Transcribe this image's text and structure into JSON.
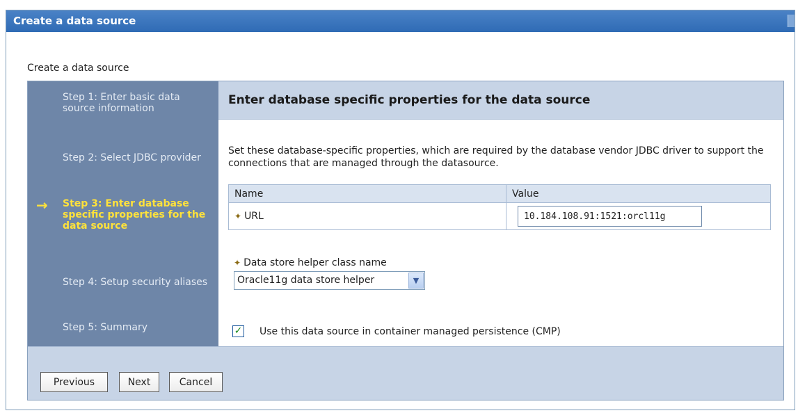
{
  "window": {
    "title": "Create a data source"
  },
  "page": {
    "heading": "Create a data source"
  },
  "wizard": {
    "steps": [
      {
        "label": "Step 1: Enter basic data source information",
        "current": false
      },
      {
        "label": "Step 2: Select JDBC provider",
        "current": false
      },
      {
        "label": "Step 3: Enter database specific properties for the data source",
        "current": true
      },
      {
        "label": "Step 4: Setup security aliases",
        "current": false
      },
      {
        "label": "Step 5: Summary",
        "current": false
      }
    ],
    "current_step_icon": "right-arrow-icon"
  },
  "content": {
    "header": "Enter database specific properties for the data source",
    "description": "Set these database-specific properties, which are required by the database vendor JDBC driver to support the connections that are managed through the datasource.",
    "table": {
      "columns": [
        "Name",
        "Value"
      ],
      "rows": [
        {
          "required": true,
          "name": "URL",
          "value": "10.184.108.91:1521:orcl11g"
        }
      ]
    },
    "helper": {
      "required": true,
      "label": "Data store helper class name",
      "selected": "Oracle11g data store helper"
    },
    "cmp": {
      "checked": true,
      "label": "Use this data source in container managed persistence (CMP)"
    }
  },
  "buttons": {
    "previous": "Previous",
    "next": "Next",
    "cancel": "Cancel"
  },
  "colors": {
    "title_bar": "#2f6bb5",
    "steps_panel": "#6e86a8",
    "current_step": "#ffe23b",
    "header_band": "#c7d4e6"
  }
}
